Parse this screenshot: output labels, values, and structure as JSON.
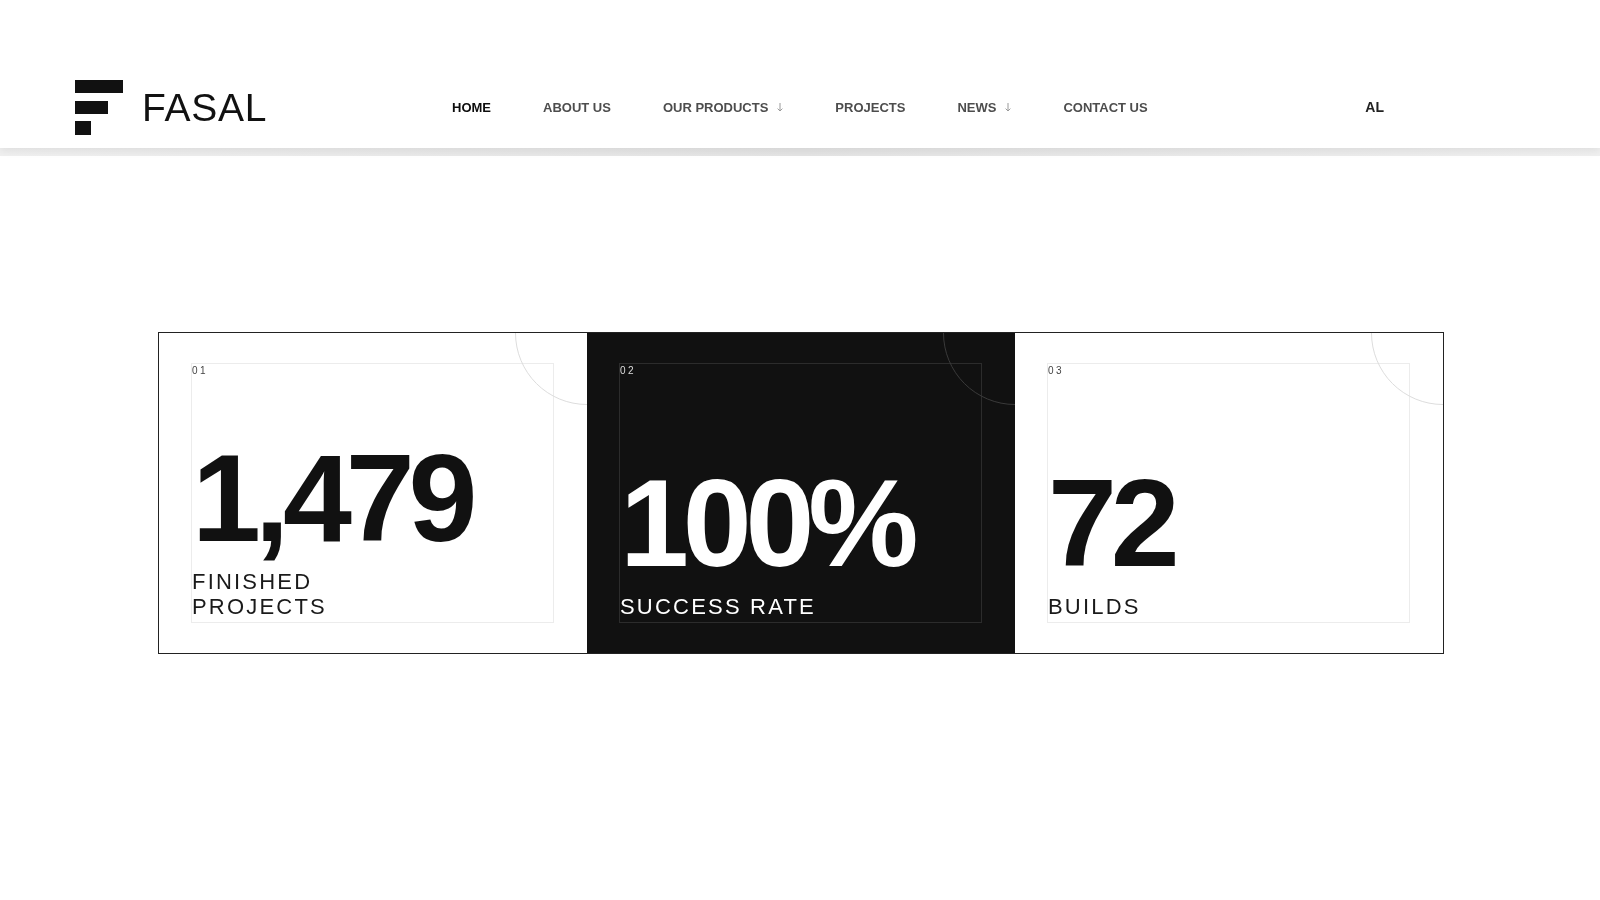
{
  "header": {
    "logo": {
      "text": "FASAL"
    },
    "nav": [
      {
        "label": "HOME",
        "selected": true,
        "dropdown": false
      },
      {
        "label": "ABOUT US",
        "selected": false,
        "dropdown": false
      },
      {
        "label": "OUR PRODUCTS",
        "selected": false,
        "dropdown": true
      },
      {
        "label": "PROJECTS",
        "selected": false,
        "dropdown": false
      },
      {
        "label": "NEWS",
        "selected": false,
        "dropdown": true
      },
      {
        "label": "CONTACT US",
        "selected": false,
        "dropdown": false
      }
    ],
    "language": "AL"
  },
  "stats": [
    {
      "index": "01",
      "value": "1,479",
      "label_lines": [
        "FINISHED",
        "PROJECTS"
      ],
      "highlighted": false
    },
    {
      "index": "02",
      "value": "100%",
      "label_lines": [
        "SUCCESS RATE"
      ],
      "highlighted": true
    },
    {
      "index": "03",
      "value": "72",
      "label_lines": [
        "BUILDS"
      ],
      "highlighted": false
    }
  ]
}
